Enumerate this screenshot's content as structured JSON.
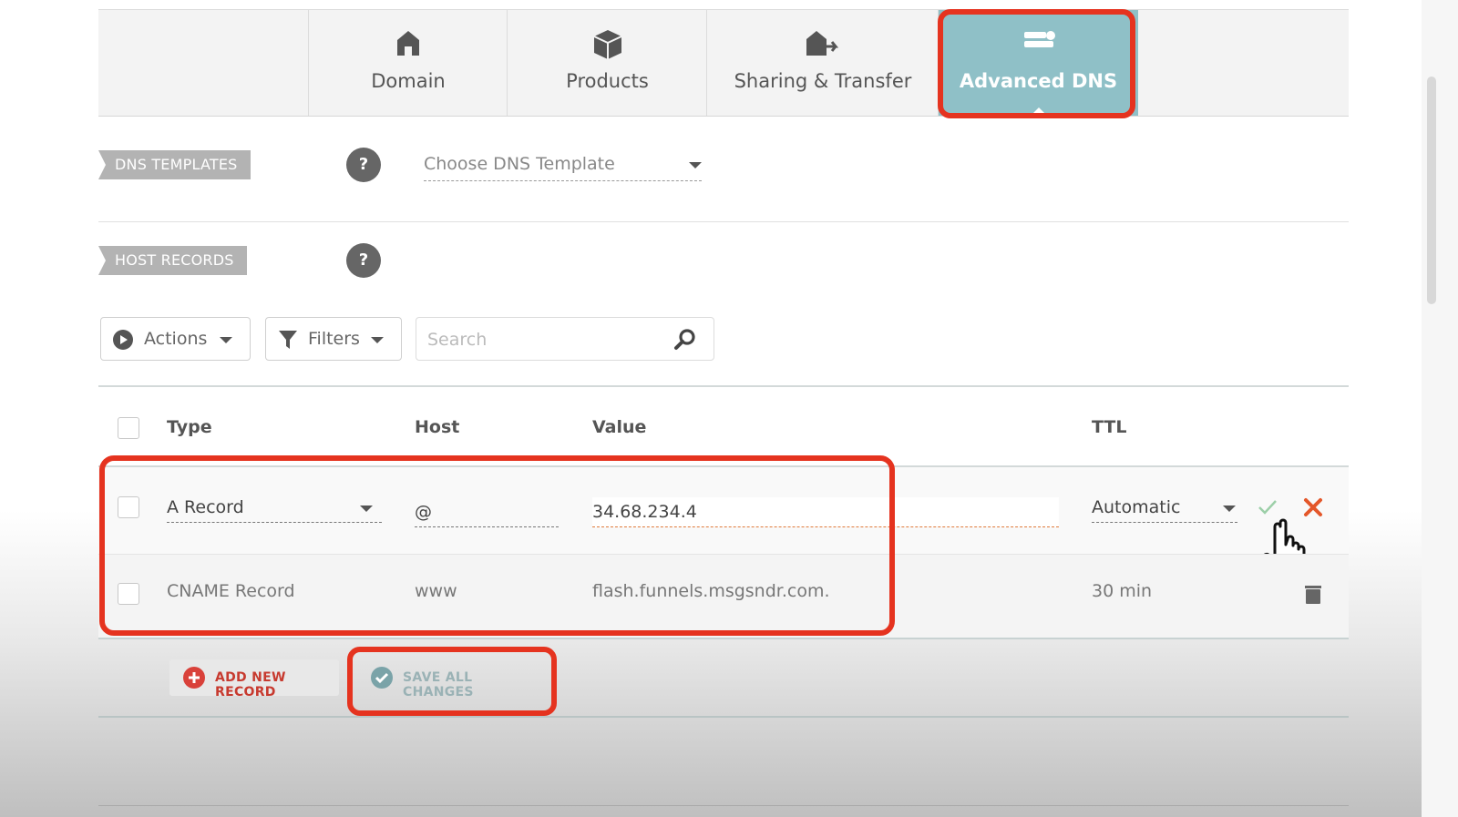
{
  "tabs": [
    {
      "label": "Domain",
      "icon": "home-icon",
      "active": false
    },
    {
      "label": "Products",
      "icon": "box-icon",
      "active": false
    },
    {
      "label": "Sharing & Transfer",
      "icon": "transfer-icon",
      "active": false
    },
    {
      "label": "Advanced DNS",
      "icon": "server-icon",
      "active": true
    }
  ],
  "dns_templates": {
    "label": "DNS TEMPLATES",
    "help": "?",
    "select_value": "Choose DNS Template"
  },
  "host_records": {
    "label": "HOST RECORDS",
    "help": "?"
  },
  "toolbar": {
    "actions_label": "Actions",
    "filters_label": "Filters",
    "search_placeholder": "Search"
  },
  "table": {
    "headers": {
      "type": "Type",
      "host": "Host",
      "value": "Value",
      "ttl": "TTL"
    },
    "rows": [
      {
        "type": "A Record",
        "host": "@",
        "value": "34.68.234.4",
        "ttl": "Automatic",
        "editing": true
      },
      {
        "type": "CNAME Record",
        "host": "www",
        "value": "flash.funnels.msgsndr.com.",
        "ttl": "30 min",
        "editing": false
      }
    ]
  },
  "footer": {
    "add_label": "ADD NEW RECORD",
    "save_label": "SAVE ALL CHANGES"
  },
  "colors": {
    "active_tab": "#8fc0c7",
    "highlight": "#e5331f",
    "add_icon": "#d9413a",
    "save_icon": "#7aa3a8"
  }
}
